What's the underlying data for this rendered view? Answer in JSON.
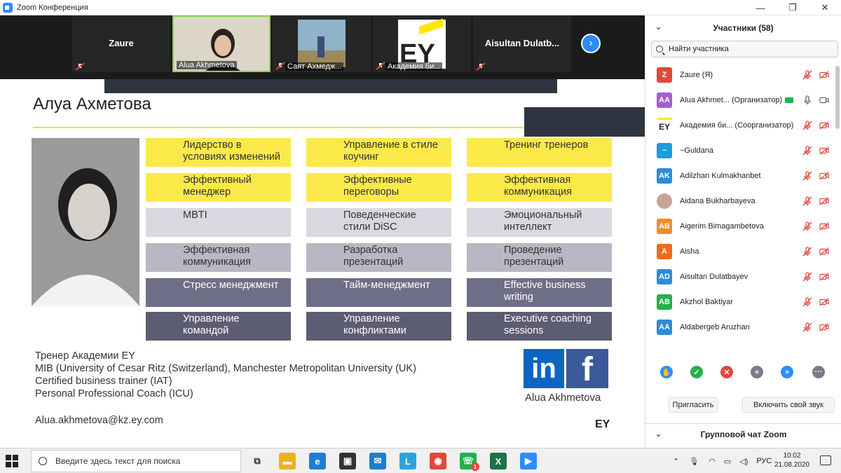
{
  "window": {
    "title": "Zoom Конференция",
    "minimize": "—",
    "maximize": "❐",
    "close": "✕"
  },
  "strip": {
    "tiles": [
      {
        "name": "Zaure",
        "style": "name-only"
      },
      {
        "name": "Alua Akhmetova",
        "style": "video"
      },
      {
        "name": "Саят Ахмедж...",
        "style": "video"
      },
      {
        "name": "Академия би...",
        "style": "logo",
        "logo_text": "EY"
      },
      {
        "name": "Aisultan  Dulatb...",
        "style": "name-only"
      }
    ],
    "next_label": "›"
  },
  "slide": {
    "heading": "Алуа Ахметова",
    "grid": [
      [
        "Лидерство в условиях изменений",
        "Управление в стиле коучинг",
        "Тренинг тренеров"
      ],
      [
        "Эффективный менеджер",
        "Эффективные переговоры",
        "Эффективная коммуникация"
      ],
      [
        "MBTI",
        "Поведенческие стили DiSC",
        "Эмоциональный интеллект"
      ],
      [
        "Эффективная коммуникация",
        "Разработка презентаций",
        "Проведение презентаций"
      ],
      [
        "Стресс менеджмент",
        "Тайм-менеджмент",
        "Effective business writing"
      ],
      [
        "Управление командой",
        "Управление конфликтами",
        "Executive coaching sessions"
      ]
    ],
    "bio": [
      "Тренер Академии EY",
      "MIB (University of Cesar Ritz (Switzerland), Manchester Metropolitan University (UK)",
      "Certified business trainer (IAT)",
      "Personal Professional Coach (ICU)"
    ],
    "email": "Alua.akhmetova@kz.ey.com",
    "linkedin_text": "in",
    "facebook_text": "f",
    "signature_name": "Alua Akhmetova",
    "logo_small": "EY"
  },
  "panel": {
    "title": "Участники (58)",
    "search_placeholder": "Найти участника",
    "participants": [
      {
        "initials": "Z",
        "color": "#e0483b",
        "name": "Zaure (Я)"
      },
      {
        "initials": "AA",
        "color": "#a55ecf",
        "name": "Alua Akhmet... (Организатор)",
        "host": true
      },
      {
        "initials": "EY",
        "color": "#ffffff",
        "name": "Академия би... (Соорганизатор)",
        "logo": true
      },
      {
        "initials": "~",
        "color": "#1a9fd9",
        "name": "~Guldana"
      },
      {
        "initials": "AK",
        "color": "#2d8cd9",
        "name": "Adilzhan Kulmakhanbet"
      },
      {
        "initials": "",
        "color": "#c9a39a",
        "name": "Aidana Bukharbayeva",
        "photo": true
      },
      {
        "initials": "AB",
        "color": "#f08c2a",
        "name": "Aigerim Bimagambetova"
      },
      {
        "initials": "A",
        "color": "#f06a1d",
        "name": "Aisha"
      },
      {
        "initials": "AD",
        "color": "#2d8cd9",
        "name": "Aisultan Dulatbayev"
      },
      {
        "initials": "AB",
        "color": "#23b14d",
        "name": "Akzhol Baktiyar"
      },
      {
        "initials": "AA",
        "color": "#2d8cd9",
        "name": "Aldabergeb Aruzhan"
      }
    ],
    "actions": [
      {
        "icon": "raise-hand-icon",
        "color": "#2d8cff",
        "glyph": "✋"
      },
      {
        "icon": "yes-icon",
        "color": "#23b14d",
        "glyph": "✓"
      },
      {
        "icon": "no-icon",
        "color": "#e0483b",
        "glyph": "✕"
      },
      {
        "icon": "slower-icon",
        "color": "#7b7b86",
        "glyph": "«"
      },
      {
        "icon": "faster-icon",
        "color": "#2d8cff",
        "glyph": "»"
      },
      {
        "icon": "more-icon",
        "color": "#7b7b86",
        "glyph": "···"
      }
    ],
    "invite_label": "Пригласить",
    "unmute_label": "Включить свой звук",
    "chat_title": "Групповой чат Zoom"
  },
  "taskbar": {
    "search_placeholder": "Введите здесь текст для поиска",
    "lang": "РУС",
    "time": "10:02",
    "date": "21.08.2020",
    "apps": [
      {
        "icon": "task-view-icon",
        "color": "#f0f0f0",
        "glyph": "⧉"
      },
      {
        "icon": "file-explorer-icon",
        "color": "#f2b01e",
        "glyph": "▬"
      },
      {
        "icon": "edge-icon",
        "color": "#1a7fd4",
        "glyph": "e"
      },
      {
        "icon": "store-icon",
        "color": "#333333",
        "glyph": "▣"
      },
      {
        "icon": "mail-icon",
        "color": "#1a7fd4",
        "glyph": "✉"
      },
      {
        "icon": "l-app-icon",
        "color": "#2ea3dc",
        "glyph": "L"
      },
      {
        "icon": "chrome-icon",
        "color": "#e0483b",
        "glyph": "◉"
      },
      {
        "icon": "whatsapp-icon",
        "color": "#23b14d",
        "glyph": "☏"
      },
      {
        "icon": "excel-icon",
        "color": "#1e7145",
        "glyph": "X"
      },
      {
        "icon": "zoom-icon",
        "color": "#2d8cff",
        "glyph": "▶"
      }
    ],
    "whatsapp_badge": "1"
  }
}
